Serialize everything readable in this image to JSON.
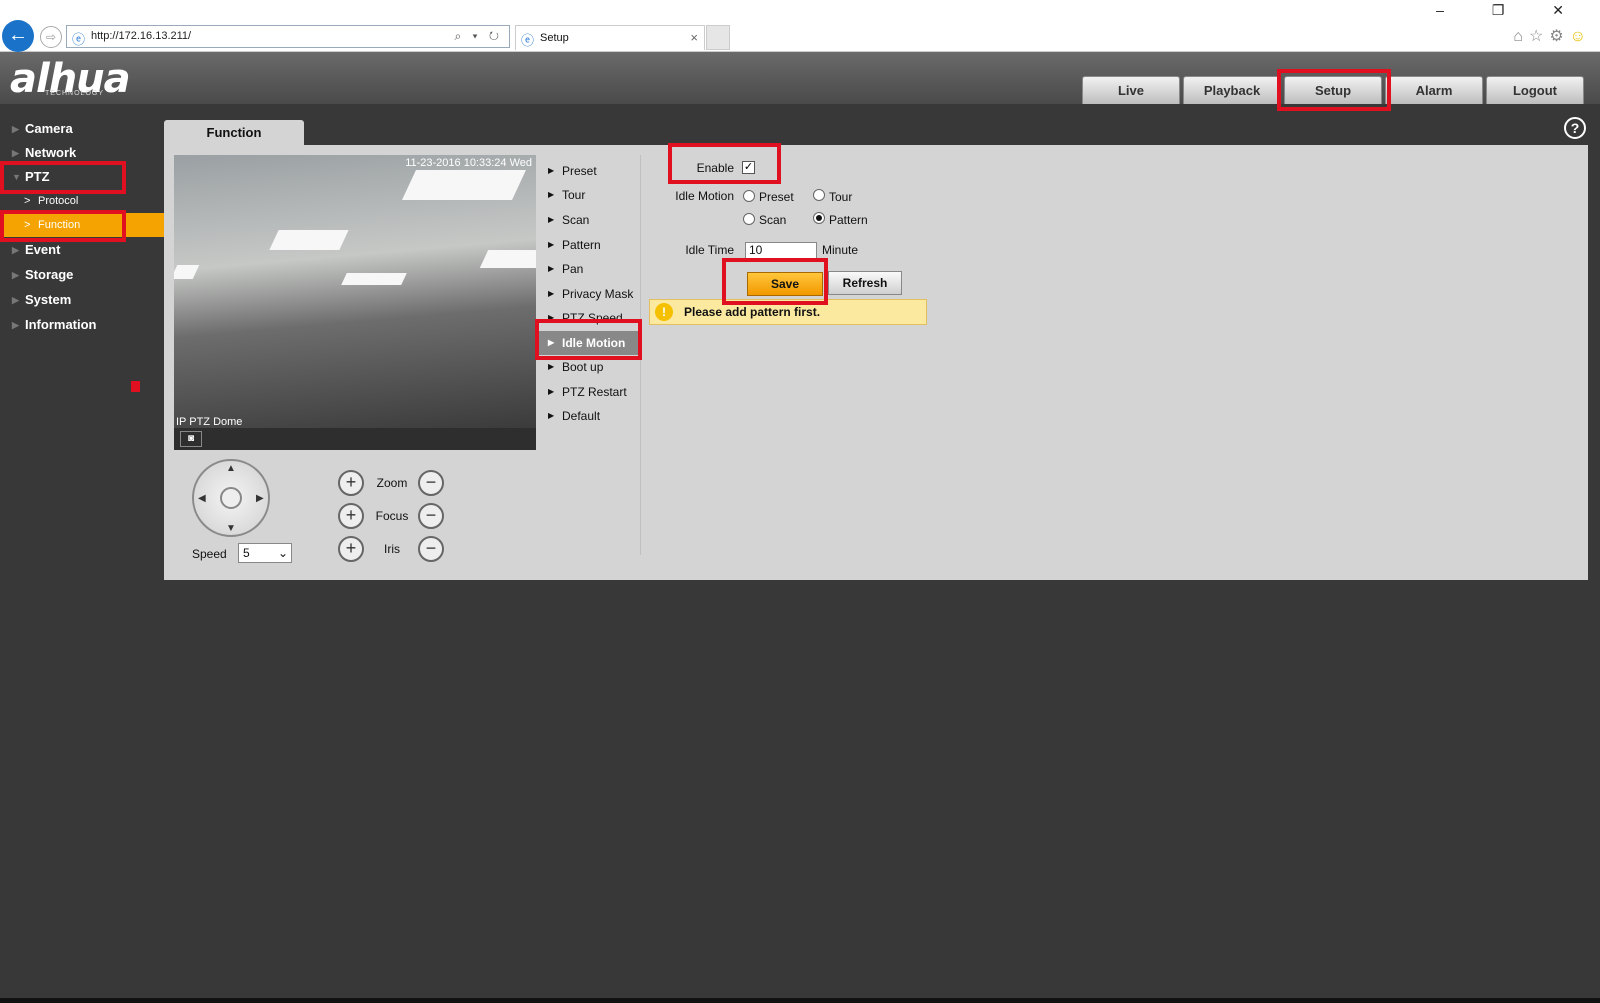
{
  "browser": {
    "url": "http://172.16.13.211/",
    "tab_title": "Setup",
    "address_tools": "⌕ ▾ ↻",
    "window_controls": "– ❐ ✕",
    "icons": [
      "home-icon",
      "star-icon",
      "gear-icon",
      "smiley-icon"
    ]
  },
  "header": {
    "logo": "alhua",
    "logo_sub": "TECHNOLOGY",
    "tabs": [
      "Live",
      "Playback",
      "Setup",
      "Alarm",
      "Logout"
    ],
    "active_tab": "Setup"
  },
  "sidebar": {
    "items": [
      "Camera",
      "Network",
      "PTZ",
      "Event",
      "Storage",
      "System",
      "Information"
    ],
    "ptz_subitems": [
      "Protocol",
      "Function"
    ],
    "active": "Function"
  },
  "panel": {
    "tab_title": "Function",
    "help": "?"
  },
  "video": {
    "timestamp": "11-23-2016 10:33:24 Wed",
    "camera_name": "IP PTZ Dome"
  },
  "ptz_controls": {
    "speed_label": "Speed",
    "speed_value": "5",
    "zoom_label": "Zoom",
    "focus_label": "Focus",
    "iris_label": "Iris",
    "plus": "+",
    "minus": "−"
  },
  "function_menu": {
    "items": [
      "Preset",
      "Tour",
      "Scan",
      "Pattern",
      "Pan",
      "Privacy Mask",
      "PTZ Speed",
      "Idle Motion",
      "Boot up",
      "PTZ Restart",
      "Default"
    ],
    "selected": "Idle Motion"
  },
  "form": {
    "enable_label": "Enable",
    "enable_checked": true,
    "check_mark": "✓",
    "idle_motion_label": "Idle Motion",
    "options": [
      "Preset",
      "Tour",
      "Scan",
      "Pattern"
    ],
    "selected_option": "Pattern",
    "idle_time_label": "Idle Time",
    "idle_time_value": "10",
    "idle_time_unit": "Minute",
    "save_label": "Save",
    "refresh_label": "Refresh",
    "warning_icon": "!",
    "warning_text": "Please add pattern first."
  },
  "colors": {
    "highlight_red": "#e01020",
    "active_orange": "#f5a300",
    "save_yellow": "#ffc63a",
    "warning_bg": "#fbe9a0"
  }
}
